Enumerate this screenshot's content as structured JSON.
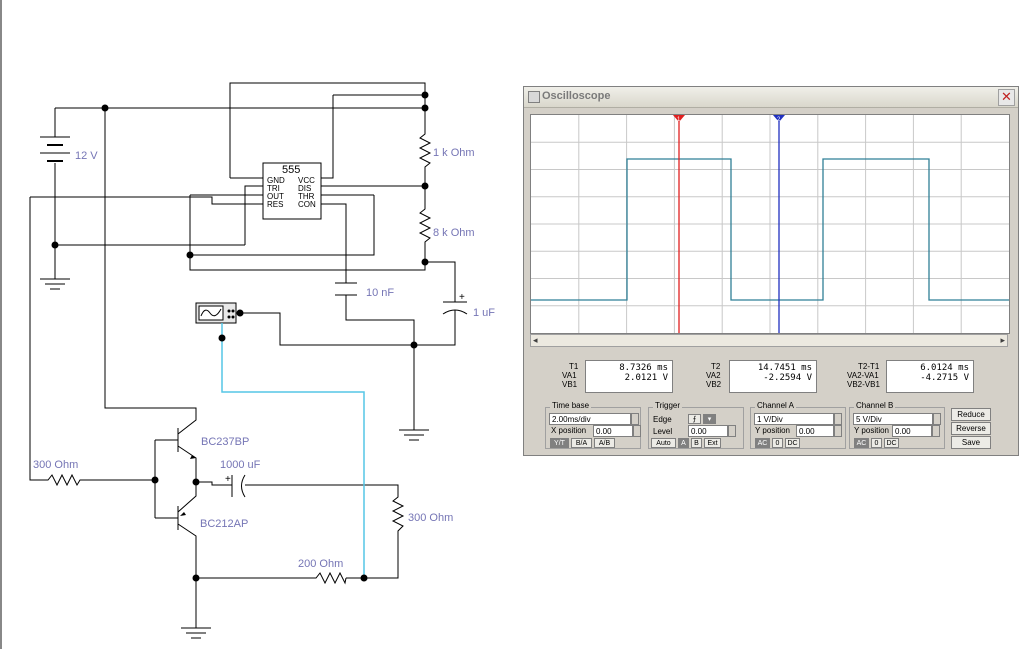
{
  "schematic": {
    "chip_name": "555",
    "pins_left": [
      "GND",
      "TRI",
      "OUT",
      "RES"
    ],
    "pins_right": [
      "VCC",
      "DIS",
      "THR",
      "CON"
    ],
    "battery_label": "12 V",
    "r1_label": "1 k Ohm",
    "r2_label": "8 k Ohm",
    "c_con_label": "10 nF",
    "c_timing_label": "1 uF",
    "r_base_label": "300  Ohm",
    "q1_label": "BC237BP",
    "q2_label": "BC212AP",
    "c_out_label": "1000 uF",
    "r_load_label": "300  Ohm",
    "r_fb_label": "200  Ohm",
    "colors": {
      "wire": "#000000",
      "probe_wire": "#55c6e6",
      "label": "#7575b5"
    }
  },
  "oscilloscope": {
    "title": "Oscilloscope",
    "close_icon": "close-icon",
    "trace_color": "#2f7f96",
    "cursor1_color": "#e02020",
    "cursor2_color": "#2030c0",
    "cursor1_tag": "1",
    "cursor2_tag": "2",
    "readout": {
      "t1": {
        "label": "T1",
        "value": "8.7326 ms"
      },
      "va1": {
        "label": "VA1",
        "value": "2.0121  V"
      },
      "vb1": {
        "label": "VB1"
      },
      "t2": {
        "label": "T2",
        "value": "14.7451 ms"
      },
      "va2": {
        "label": "VA2",
        "value": "-2.2594  V"
      },
      "vb2": {
        "label": "VB2"
      },
      "dt": {
        "label": "T2-T1",
        "value": "6.0124 ms"
      },
      "dva": {
        "label": "VA2-VA1",
        "value": "-4.2715  V"
      },
      "dvb": {
        "label": "VB2-VB1"
      }
    },
    "timebase": {
      "title": "Time base",
      "value": "2.00ms/div",
      "xpos_label": "X position",
      "xpos": "0.00",
      "buttons": [
        "Y/T",
        "B/A",
        "A/B"
      ]
    },
    "trigger": {
      "title": "Trigger",
      "edge_label": "Edge",
      "level_label": "Level",
      "level": "0.00",
      "buttons": [
        "Auto",
        "A",
        "B",
        "Ext"
      ]
    },
    "channel_a": {
      "title": "Channel A",
      "value": "1  V/Div",
      "ypos_label": "Y position",
      "ypos": "0.00",
      "buttons": [
        "AC",
        "0",
        "DC"
      ]
    },
    "channel_b": {
      "title": "Channel B",
      "value": "5  V/Div",
      "ypos_label": "Y position",
      "ypos": "0.00",
      "buttons": [
        "AC",
        "0",
        "DC"
      ]
    },
    "side_buttons": [
      "Reduce",
      "Reverse",
      "Save"
    ]
  }
}
